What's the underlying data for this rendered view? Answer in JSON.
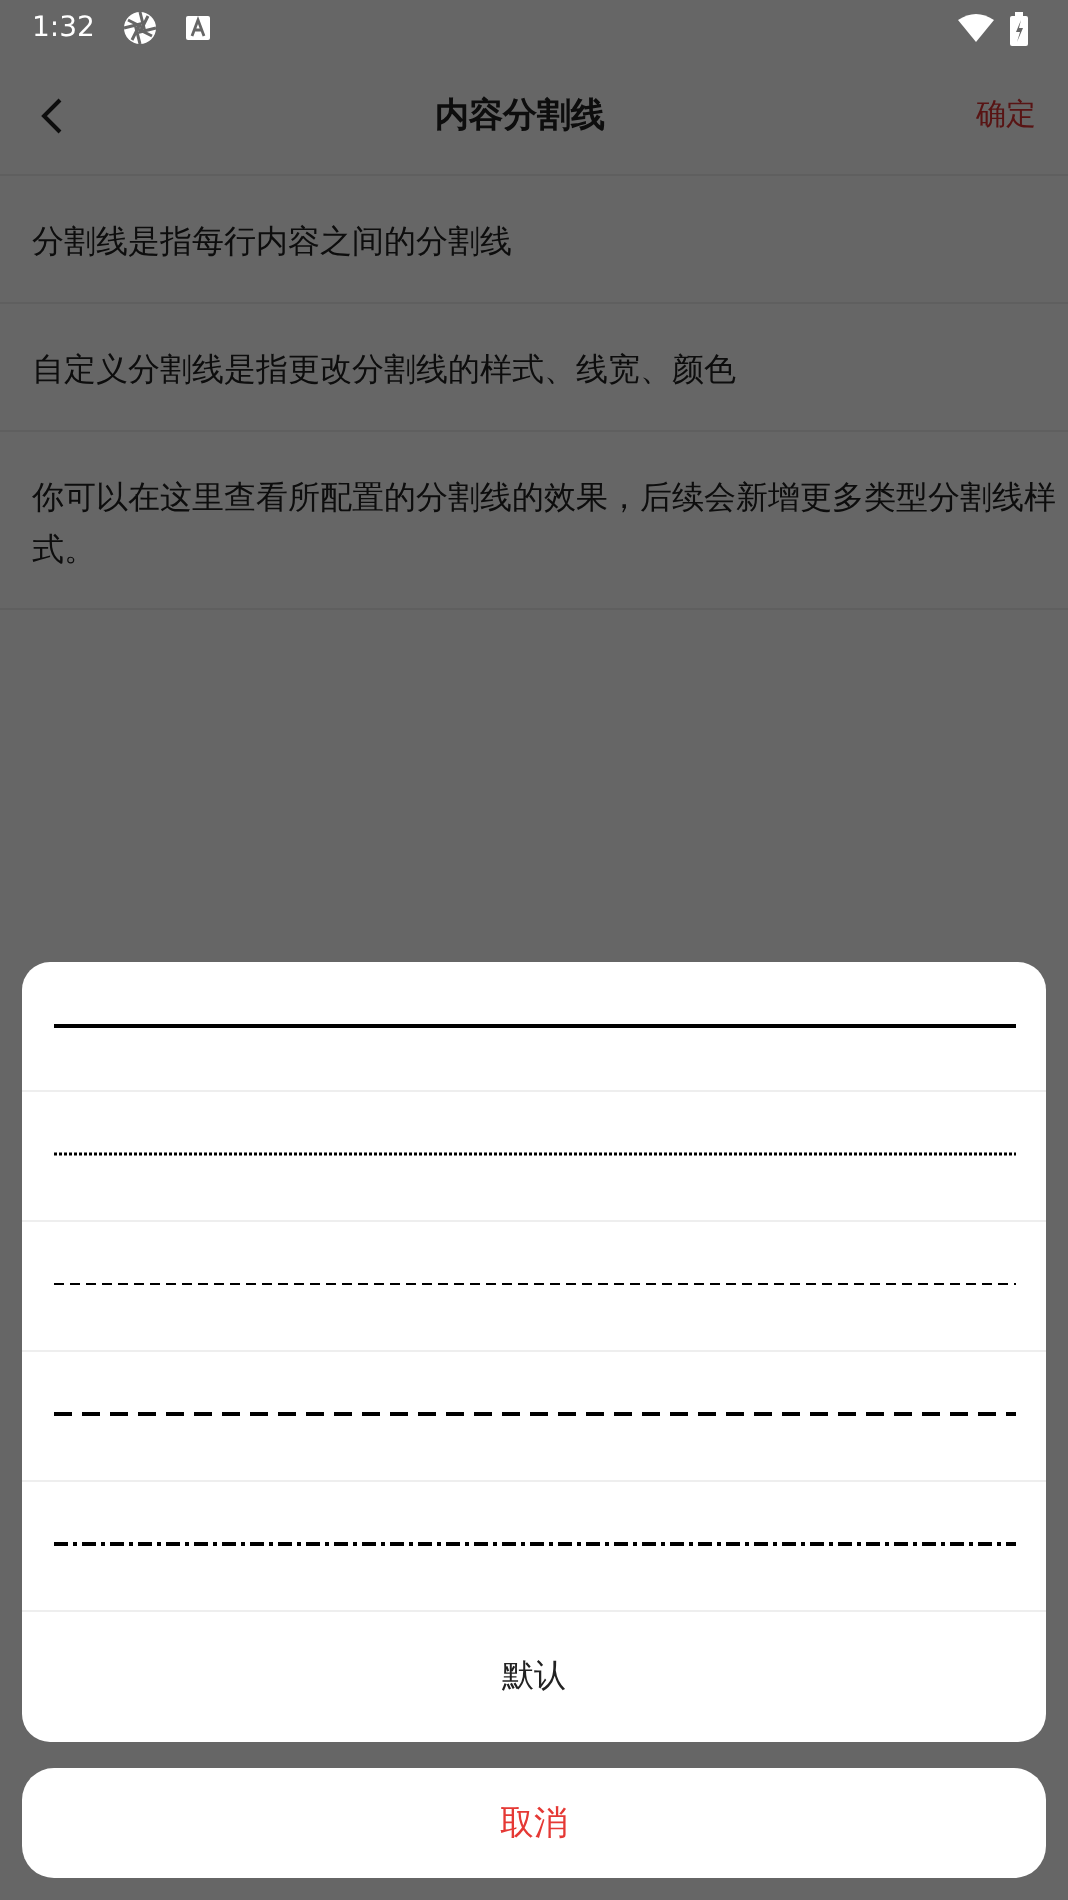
{
  "status_bar": {
    "time": "1:32"
  },
  "header": {
    "title": "内容分割线",
    "confirm": "确定"
  },
  "items": [
    {
      "text": "分割线是指每行内容之间的分割线"
    },
    {
      "text": "自定义分割线是指更改分割线的样式、线宽、颜色"
    },
    {
      "text": "你可以在这里查看所配置的分割线的效果，后续会新增更多类型分割线样式。"
    }
  ],
  "sheet": {
    "options": [
      {
        "kind": "solid"
      },
      {
        "kind": "dotted"
      },
      {
        "kind": "dashed"
      },
      {
        "kind": "long-dashed"
      },
      {
        "kind": "dash-dot"
      }
    ],
    "default_label": "默认",
    "cancel": "取消"
  }
}
